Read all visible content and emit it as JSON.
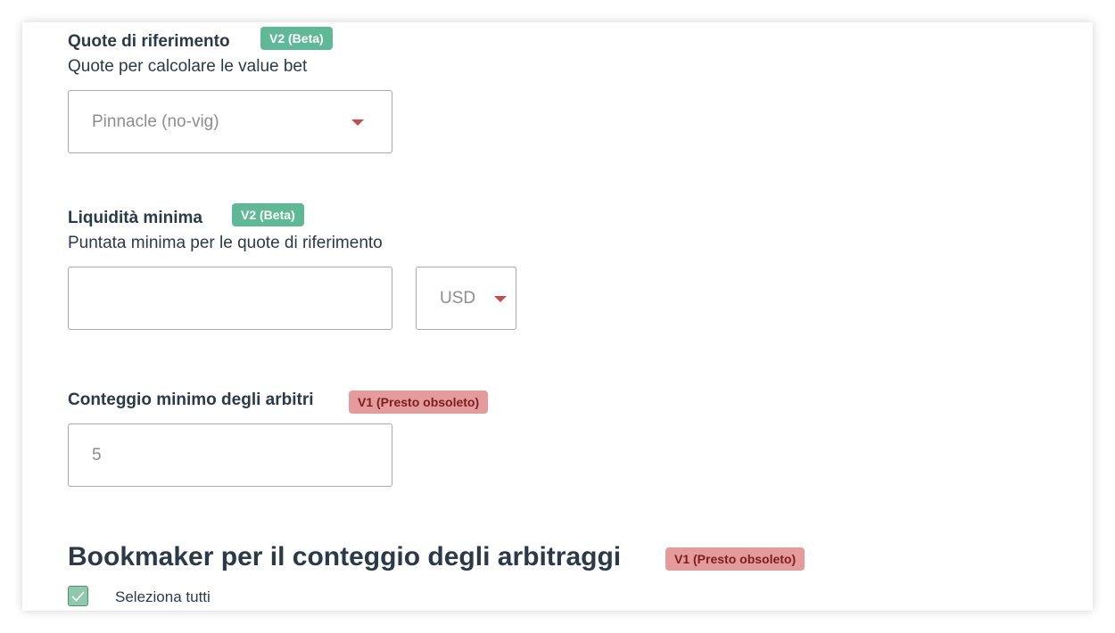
{
  "reference_odds": {
    "label": "Quote di riferimento",
    "badge": "V2 (Beta)",
    "description": "Quote per calcolare le value bet",
    "select_value": "Pinnacle (no-vig)"
  },
  "min_liquidity": {
    "label": "Liquidità minima",
    "badge": "V2 (Beta)",
    "description": "Puntata minima per le quote di riferimento",
    "amount_value": "",
    "currency_value": "USD"
  },
  "min_arbiters": {
    "label": "Conteggio minimo degli arbitri",
    "badge": "V1 (Presto obsoleto)",
    "placeholder": "5"
  },
  "bookmakers": {
    "heading": "Bookmaker per il conteggio degli arbitraggi",
    "badge": "V1 (Presto obsoleto)",
    "select_all_label": "Seleziona tutti",
    "select_all_checked": true
  },
  "colors": {
    "badge_beta": "#5fb996",
    "badge_deprecated": "#e59b9b",
    "caret": "#c0504d",
    "text": "#2b3a48"
  },
  "icons": {
    "dropdown": "chevron-down-icon",
    "checkbox": "check-icon"
  }
}
